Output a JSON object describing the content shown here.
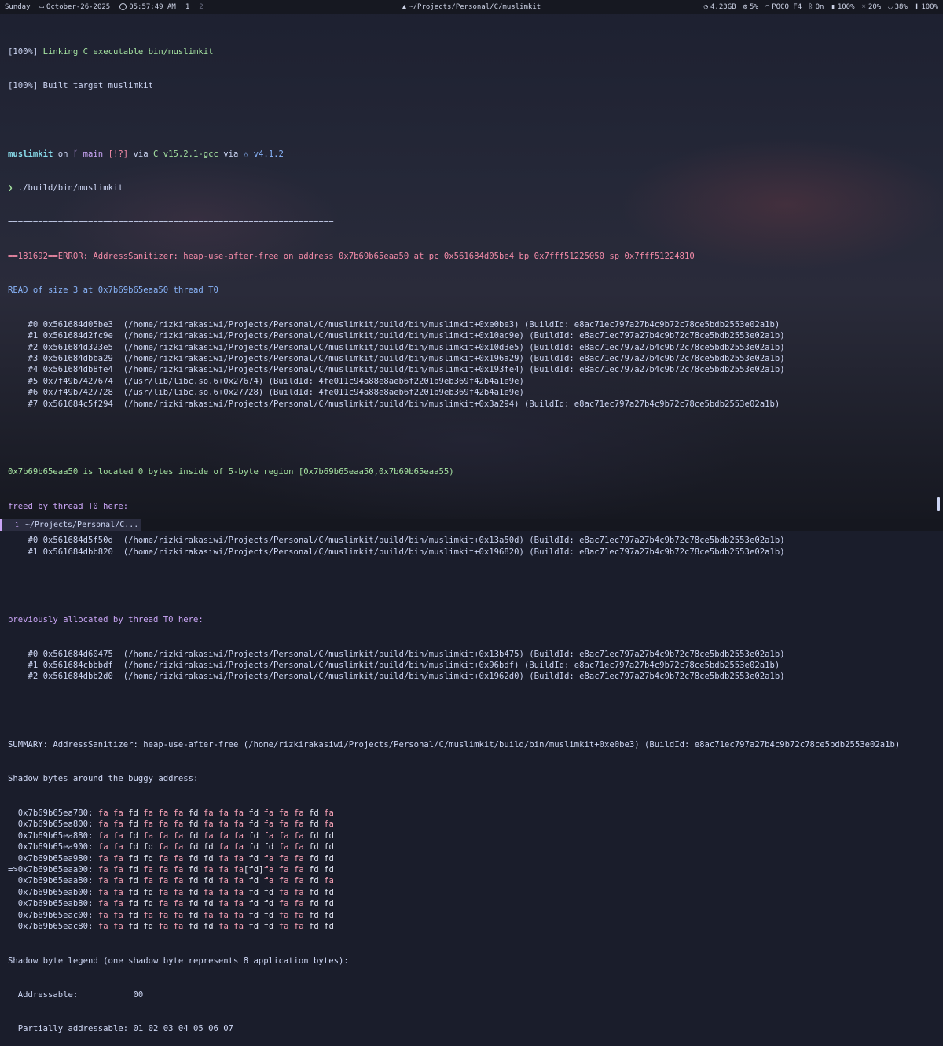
{
  "topbar": {
    "day": "Sunday",
    "date": "October-26-2025",
    "time": "05:57:49 AM",
    "workspaces": [
      "1",
      "2"
    ],
    "window_title": "~/Projects/Personal/C/muslimkit",
    "memory": "4.23GB",
    "cpu": "5%",
    "wifi": "POCO F4",
    "bluetooth": "On",
    "battery": "100%",
    "brightness": "20%",
    "volume": "38%",
    "mic": "100%"
  },
  "terminal": {
    "build1": {
      "prefix": "[100%] ",
      "text": "Linking C executable bin/muslimkit"
    },
    "build2": {
      "prefix": "[100%] ",
      "text": "Built target muslimkit"
    },
    "prompt": {
      "dir": "muslimkit",
      "on": " on ",
      "branch_icon": "",
      "branch": " main ",
      "status": "[!?]",
      "via1": " via ",
      "gcc_icon": "C ",
      "gcc": "v15.2.1-gcc",
      "via2": " via ",
      "cmake_icon": "△ ",
      "cmake": "v4.1.2"
    },
    "command": {
      "arrow": "❯ ",
      "text": "./build/bin/muslimkit"
    },
    "separator": "=================================================================",
    "error_line": "==181692==ERROR: AddressSanitizer: heap-use-after-free on address 0x7b69b65eaa50 at pc 0x561684d05be4 bp 0x7fff51225050 sp 0x7fff51224810",
    "read_line": "READ of size 3 at 0x7b69b65eaa50 thread T0",
    "stack_read": [
      "    #0 0x561684d05be3  (/home/rizkirakasiwi/Projects/Personal/C/muslimkit/build/bin/muslimkit+0xe0be3) (BuildId: e8ac71ec797a27b4c9b72c78ce5bdb2553e02a1b)",
      "    #1 0x561684d2fc9e  (/home/rizkirakasiwi/Projects/Personal/C/muslimkit/build/bin/muslimkit+0x10ac9e) (BuildId: e8ac71ec797a27b4c9b72c78ce5bdb2553e02a1b)",
      "    #2 0x561684d323e5  (/home/rizkirakasiwi/Projects/Personal/C/muslimkit/build/bin/muslimkit+0x10d3e5) (BuildId: e8ac71ec797a27b4c9b72c78ce5bdb2553e02a1b)",
      "    #3 0x561684dbba29  (/home/rizkirakasiwi/Projects/Personal/C/muslimkit/build/bin/muslimkit+0x196a29) (BuildId: e8ac71ec797a27b4c9b72c78ce5bdb2553e02a1b)",
      "    #4 0x561684db8fe4  (/home/rizkirakasiwi/Projects/Personal/C/muslimkit/build/bin/muslimkit+0x193fe4) (BuildId: e8ac71ec797a27b4c9b72c78ce5bdb2553e02a1b)",
      "    #5 0x7f49b7427674  (/usr/lib/libc.so.6+0x27674) (BuildId: 4fe011c94a88e8aeb6f2201b9eb369f42b4a1e9e)",
      "    #6 0x7f49b7427728  (/usr/lib/libc.so.6+0x27728) (BuildId: 4fe011c94a88e8aeb6f2201b9eb369f42b4a1e9e)",
      "    #7 0x561684c5f294  (/home/rizkirakasiwi/Projects/Personal/C/muslimkit/build/bin/muslimkit+0x3a294) (BuildId: e8ac71ec797a27b4c9b72c78ce5bdb2553e02a1b)"
    ],
    "located_line": "0x7b69b65eaa50 is located 0 bytes inside of 5-byte region [0x7b69b65eaa50,0x7b69b65eaa55)",
    "freed_line": "freed by thread T0 here:",
    "stack_freed": [
      "    #0 0x561684d5f50d  (/home/rizkirakasiwi/Projects/Personal/C/muslimkit/build/bin/muslimkit+0x13a50d) (BuildId: e8ac71ec797a27b4c9b72c78ce5bdb2553e02a1b)",
      "    #1 0x561684dbb820  (/home/rizkirakasiwi/Projects/Personal/C/muslimkit/build/bin/muslimkit+0x196820) (BuildId: e8ac71ec797a27b4c9b72c78ce5bdb2553e02a1b)"
    ],
    "alloc_line": "previously allocated by thread T0 here:",
    "stack_alloc": [
      "    #0 0x561684d60475  (/home/rizkirakasiwi/Projects/Personal/C/muslimkit/build/bin/muslimkit+0x13b475) (BuildId: e8ac71ec797a27b4c9b72c78ce5bdb2553e02a1b)",
      "    #1 0x561684cbbbdf  (/home/rizkirakasiwi/Projects/Personal/C/muslimkit/build/bin/muslimkit+0x96bdf) (BuildId: e8ac71ec797a27b4c9b72c78ce5bdb2553e02a1b)",
      "    #2 0x561684dbb2d0  (/home/rizkirakasiwi/Projects/Personal/C/muslimkit/build/bin/muslimkit+0x1962d0) (BuildId: e8ac71ec797a27b4c9b72c78ce5bdb2553e02a1b)"
    ],
    "summary_line": "SUMMARY: AddressSanitizer: heap-use-after-free (/home/rizkirakasiwi/Projects/Personal/C/muslimkit/build/bin/muslimkit+0xe0be3) (BuildId: e8ac71ec797a27b4c9b72c78ce5bdb2553e02a1b)",
    "shadow_header": "Shadow bytes around the buggy address:",
    "shadow_rows": [
      {
        "prefix": "  ",
        "addr": "0x7b69b65ea780:",
        "bytes": [
          "fa",
          "fa",
          "fd",
          "fa",
          "fa",
          "fa",
          "fd",
          "fa",
          "fa",
          "fa",
          "fd",
          "fa",
          "fa",
          "fa",
          "fd",
          "fa"
        ]
      },
      {
        "prefix": "  ",
        "addr": "0x7b69b65ea800:",
        "bytes": [
          "fa",
          "fa",
          "fd",
          "fa",
          "fa",
          "fa",
          "fd",
          "fa",
          "fa",
          "fa",
          "fd",
          "fa",
          "fa",
          "fa",
          "fd",
          "fa"
        ]
      },
      {
        "prefix": "  ",
        "addr": "0x7b69b65ea880:",
        "bytes": [
          "fa",
          "fa",
          "fd",
          "fa",
          "fa",
          "fa",
          "fd",
          "fa",
          "fa",
          "fa",
          "fd",
          "fa",
          "fa",
          "fa",
          "fd",
          "fd"
        ]
      },
      {
        "prefix": "  ",
        "addr": "0x7b69b65ea900:",
        "bytes": [
          "fa",
          "fa",
          "fd",
          "fd",
          "fa",
          "fa",
          "fd",
          "fd",
          "fa",
          "fa",
          "fd",
          "fd",
          "fa",
          "fa",
          "fd",
          "fd"
        ]
      },
      {
        "prefix": "  ",
        "addr": "0x7b69b65ea980:",
        "bytes": [
          "fa",
          "fa",
          "fd",
          "fd",
          "fa",
          "fa",
          "fd",
          "fd",
          "fa",
          "fa",
          "fd",
          "fa",
          "fa",
          "fa",
          "fd",
          "fd"
        ]
      },
      {
        "prefix": "=>",
        "addr": "0x7b69b65eaa00:",
        "bytes": [
          "fa",
          "fa",
          "fd",
          "fa",
          "fa",
          "fa",
          "fd",
          "fa",
          "fa",
          "fa",
          "[fd]",
          "fa",
          "fa",
          "fa",
          "fd",
          "fd"
        ]
      },
      {
        "prefix": "  ",
        "addr": "0x7b69b65eaa80:",
        "bytes": [
          "fa",
          "fa",
          "fd",
          "fa",
          "fa",
          "fa",
          "fd",
          "fd",
          "fa",
          "fa",
          "fd",
          "fa",
          "fa",
          "fa",
          "fd",
          "fa"
        ]
      },
      {
        "prefix": "  ",
        "addr": "0x7b69b65eab00:",
        "bytes": [
          "fa",
          "fa",
          "fd",
          "fd",
          "fa",
          "fa",
          "fd",
          "fa",
          "fa",
          "fa",
          "fd",
          "fd",
          "fa",
          "fa",
          "fd",
          "fd"
        ]
      },
      {
        "prefix": "  ",
        "addr": "0x7b69b65eab80:",
        "bytes": [
          "fa",
          "fa",
          "fd",
          "fd",
          "fa",
          "fa",
          "fd",
          "fd",
          "fa",
          "fa",
          "fd",
          "fd",
          "fa",
          "fa",
          "fd",
          "fd"
        ]
      },
      {
        "prefix": "  ",
        "addr": "0x7b69b65eac00:",
        "bytes": [
          "fa",
          "fa",
          "fd",
          "fa",
          "fa",
          "fa",
          "fd",
          "fa",
          "fa",
          "fa",
          "fd",
          "fd",
          "fa",
          "fa",
          "fd",
          "fd"
        ]
      },
      {
        "prefix": "  ",
        "addr": "0x7b69b65eac80:",
        "bytes": [
          "fa",
          "fa",
          "fd",
          "fd",
          "fa",
          "fa",
          "fd",
          "fd",
          "fa",
          "fa",
          "fd",
          "fd",
          "fa",
          "fa",
          "fd",
          "fd"
        ]
      }
    ],
    "legend_header": "Shadow byte legend (one shadow byte represents 8 application bytes):",
    "legend_addressable": "  Addressable:           00",
    "legend_partial": "  Partially addressable: 01 02 03 04 05 06 07"
  },
  "bottombar": {
    "tab_number": "1",
    "tab_title": "~/Projects/Personal/C..."
  }
}
